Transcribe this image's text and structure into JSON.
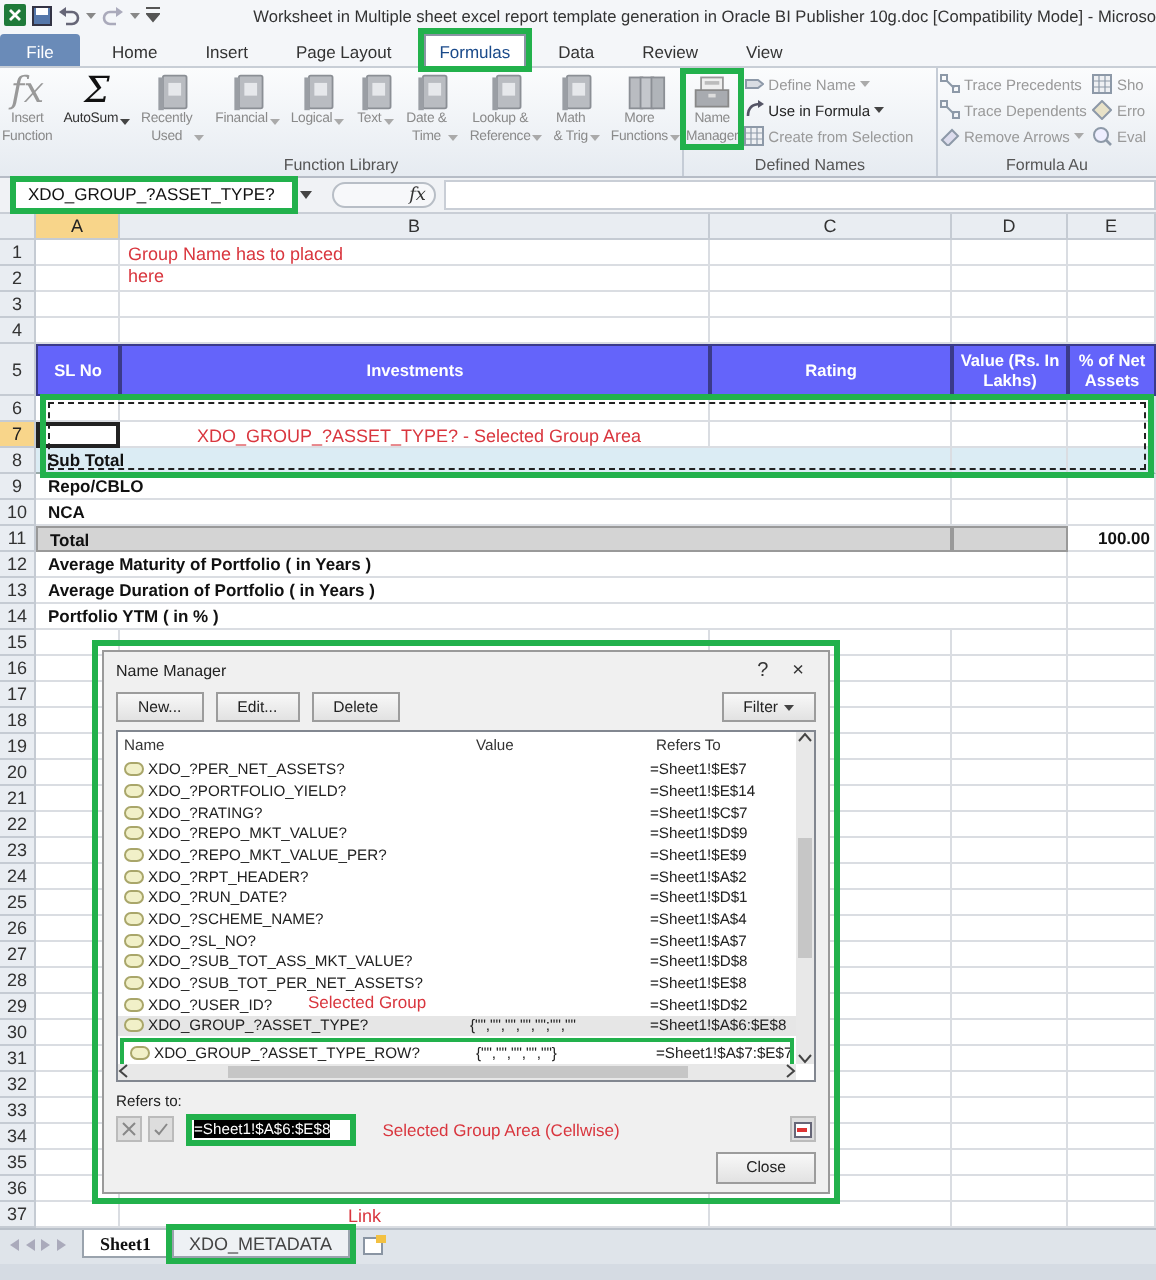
{
  "title_bar": {
    "title": "Worksheet in Multiple sheet excel report template generation in Oracle BI Publisher 10g.doc  [Compatibility Mode]  -  Microso"
  },
  "ribbon_tabs": [
    {
      "label": "File",
      "kind": "file",
      "selected": false,
      "highlighted": false
    },
    {
      "label": "Home",
      "kind": "tab",
      "selected": false,
      "highlighted": false
    },
    {
      "label": "Insert",
      "kind": "tab",
      "selected": false,
      "highlighted": false
    },
    {
      "label": "Page Layout",
      "kind": "tab",
      "selected": false,
      "highlighted": false
    },
    {
      "label": "Formulas",
      "kind": "tab",
      "selected": true,
      "highlighted": true
    },
    {
      "label": "Data",
      "kind": "tab",
      "selected": false,
      "highlighted": false
    },
    {
      "label": "Review",
      "kind": "tab",
      "selected": false,
      "highlighted": false
    },
    {
      "label": "View",
      "kind": "tab",
      "selected": false,
      "highlighted": false
    }
  ],
  "ribbon": {
    "groups": [
      {
        "label": "Function Library",
        "buttons": [
          {
            "label": "Insert\nFunction",
            "kind": "glyph",
            "glyph": "fx",
            "disabled": true,
            "dropdown": false,
            "highlighted": false
          },
          {
            "label": "AutoSum",
            "kind": "glyph",
            "glyph": "Σ",
            "disabled": false,
            "dropdown": true,
            "highlighted": false
          },
          {
            "label": "Recently\nUsed",
            "kind": "book",
            "disabled": true,
            "dropdown": true,
            "highlighted": false
          },
          {
            "label": "Financial",
            "kind": "book",
            "disabled": true,
            "dropdown": true,
            "highlighted": false
          },
          {
            "label": "Logical",
            "kind": "book",
            "disabled": true,
            "dropdown": true,
            "highlighted": false
          },
          {
            "label": "Text",
            "kind": "book",
            "disabled": true,
            "dropdown": true,
            "highlighted": false
          },
          {
            "label": "Date &\nTime",
            "kind": "book",
            "disabled": true,
            "dropdown": true,
            "highlighted": false
          },
          {
            "label": "Lookup &\nReference",
            "kind": "book",
            "disabled": true,
            "dropdown": true,
            "highlighted": false
          },
          {
            "label": "Math\n& Trig",
            "kind": "book",
            "disabled": true,
            "dropdown": true,
            "highlighted": false
          },
          {
            "label": "More\nFunctions",
            "kind": "books",
            "disabled": true,
            "dropdown": true,
            "highlighted": false
          }
        ]
      },
      {
        "label": "Defined Names",
        "buttons": [
          {
            "label": "Name\nManager",
            "kind": "card-file",
            "disabled": true,
            "dropdown": false,
            "highlighted": true
          }
        ],
        "small_buttons": [
          {
            "label": "Define Name",
            "kind": "tag",
            "disabled": true,
            "dropdown": true
          },
          {
            "label": "Use in Formula",
            "kind": "curve",
            "disabled": false,
            "dropdown": true
          },
          {
            "label": "Create from Selection",
            "kind": "grid",
            "disabled": true,
            "dropdown": false
          }
        ]
      },
      {
        "label": "Formula Au",
        "small_buttons": [
          {
            "label": "Trace Precedents",
            "kind": "trace",
            "disabled": true,
            "dropdown": false
          },
          {
            "label": "Trace Dependents",
            "kind": "trace",
            "disabled": true,
            "dropdown": false
          },
          {
            "label": "Remove Arrows",
            "kind": "eraser",
            "disabled": true,
            "dropdown": true
          }
        ],
        "small_buttons_2": [
          {
            "label": "Sho",
            "kind": "grid",
            "disabled": true
          },
          {
            "label": "Erro",
            "kind": "diamond",
            "disabled": true
          },
          {
            "label": "Eval",
            "kind": "magnifier",
            "disabled": true
          }
        ]
      }
    ]
  },
  "formula_bar": {
    "name_box": "XDO_GROUP_?ASSET_TYPE?",
    "name_box_highlighted": true,
    "function_symbol": "fx"
  },
  "sheet": {
    "note": "Group Name has to placed here",
    "columns": [
      {
        "label": "A",
        "selected": true
      },
      {
        "label": "B",
        "selected": false
      },
      {
        "label": "C",
        "selected": false
      },
      {
        "label": "D",
        "selected": false
      },
      {
        "label": "E",
        "selected": false
      }
    ],
    "rows": [
      {
        "number": "1",
        "kind": "plain",
        "selected": false,
        "highlighted": false
      },
      {
        "number": "2",
        "kind": "plain",
        "selected": false,
        "highlighted": false
      },
      {
        "number": "3",
        "kind": "plain",
        "selected": false,
        "highlighted": false
      },
      {
        "number": "4",
        "kind": "plain",
        "selected": false,
        "highlighted": false
      },
      {
        "number": "5",
        "kind": "header",
        "selected": false,
        "highlighted": false,
        "cells": [
          {
            "text": "SL No"
          },
          {
            "text": "Investments"
          },
          {
            "text": "Rating"
          },
          {
            "text": "Value (Rs. In Lakhs)"
          },
          {
            "text": "% of Net Assets"
          }
        ]
      },
      {
        "number": "6",
        "kind": "plain",
        "selected": false,
        "highlighted": true
      },
      {
        "number": "7",
        "kind": "plain",
        "selected": true,
        "highlighted": true,
        "cells": [
          {
            "kind": "plain"
          },
          {
            "kind": "note",
            "text": "XDO_GROUP_?ASSET_TYPE? - Selected Group Area"
          },
          {
            "kind": "plain"
          },
          {
            "kind": "plain"
          },
          {
            "kind": "plain"
          }
        ]
      },
      {
        "number": "8",
        "kind": "subtotal",
        "selected": false,
        "highlighted": true,
        "cells": [
          {
            "text": "Sub Total"
          },
          {},
          {}
        ]
      },
      {
        "number": "9",
        "kind": "plain",
        "selected": false,
        "highlighted": false,
        "cells": [
          {
            "text": "Repo/CBLO"
          },
          {},
          {}
        ]
      },
      {
        "number": "10",
        "kind": "plain",
        "selected": false,
        "highlighted": false,
        "cells": [
          {
            "text": "NCA"
          },
          {},
          {}
        ]
      },
      {
        "number": "11",
        "kind": "total",
        "selected": false,
        "highlighted": false,
        "cells": [
          {
            "text": "Total",
            "shaded": true
          },
          {
            "shaded": true
          },
          {
            "text": "100.00",
            "shaded": false
          }
        ]
      },
      {
        "number": "12",
        "kind": "plain",
        "selected": false,
        "highlighted": false,
        "cells": [
          {
            "text": "Average Maturity of Portfolio ( in Years )"
          },
          {}
        ]
      },
      {
        "number": "13",
        "kind": "plain",
        "selected": false,
        "highlighted": false,
        "cells": [
          {
            "text": "Average Duration of Portfolio ( in Years )"
          },
          {}
        ]
      },
      {
        "number": "14",
        "kind": "plain",
        "selected": false,
        "highlighted": false,
        "cells": [
          {
            "text": "Portfolio YTM ( in % )"
          },
          {}
        ]
      },
      {
        "number": "15",
        "kind": "plain",
        "selected": false,
        "highlighted": false
      },
      {
        "number": "16",
        "kind": "plain",
        "selected": false,
        "highlighted": false
      },
      {
        "number": "17",
        "kind": "plain",
        "selected": false,
        "highlighted": false
      },
      {
        "number": "18",
        "kind": "plain",
        "selected": false,
        "highlighted": false
      },
      {
        "number": "19",
        "kind": "plain",
        "selected": false,
        "highlighted": false
      },
      {
        "number": "20",
        "kind": "plain",
        "selected": false,
        "highlighted": false
      },
      {
        "number": "21",
        "kind": "plain",
        "selected": false,
        "highlighted": false
      },
      {
        "number": "22",
        "kind": "plain",
        "selected": false,
        "highlighted": false
      },
      {
        "number": "23",
        "kind": "plain",
        "selected": false,
        "highlighted": false
      },
      {
        "number": "24",
        "kind": "plain",
        "selected": false,
        "highlighted": false
      },
      {
        "number": "25",
        "kind": "plain",
        "selected": false,
        "highlighted": false
      },
      {
        "number": "26",
        "kind": "plain",
        "selected": false,
        "highlighted": false
      },
      {
        "number": "27",
        "kind": "plain",
        "selected": false,
        "highlighted": false
      },
      {
        "number": "28",
        "kind": "plain",
        "selected": false,
        "highlighted": false
      },
      {
        "number": "29",
        "kind": "plain",
        "selected": false,
        "highlighted": false
      },
      {
        "number": "30",
        "kind": "plain",
        "selected": false,
        "highlighted": false
      },
      {
        "number": "31",
        "kind": "plain",
        "selected": false,
        "highlighted": false
      },
      {
        "number": "32",
        "kind": "plain",
        "selected": false,
        "highlighted": false
      },
      {
        "number": "33",
        "kind": "plain",
        "selected": false,
        "highlighted": false
      },
      {
        "number": "34",
        "kind": "plain",
        "selected": false,
        "highlighted": false
      },
      {
        "number": "35",
        "kind": "plain",
        "selected": false,
        "highlighted": false
      },
      {
        "number": "36",
        "kind": "plain",
        "selected": false,
        "highlighted": false
      },
      {
        "number": "37",
        "kind": "plain",
        "selected": false,
        "highlighted": false
      }
    ]
  },
  "name_manager": {
    "title": "Name Manager",
    "help": "?",
    "close": "×",
    "highlighted": true,
    "buttons": [
      {
        "label": "New..."
      },
      {
        "label": "Edit..."
      },
      {
        "label": "Delete"
      }
    ],
    "filter": {
      "label": "Filter",
      "dropdown": true
    },
    "columns": [
      "Name",
      "Value",
      "Refers To"
    ],
    "names": [
      {
        "name": "XDO_?PER_NET_ASSETS?",
        "refers_to": "=Sheet1!$E$7",
        "selected": false,
        "highlighted": false
      },
      {
        "name": "XDO_?PORTFOLIO_YIELD?",
        "refers_to": "=Sheet1!$E$14",
        "selected": false,
        "highlighted": false
      },
      {
        "name": "XDO_?RATING?",
        "refers_to": "=Sheet1!$C$7",
        "selected": false,
        "highlighted": false
      },
      {
        "name": "XDO_?REPO_MKT_VALUE?",
        "refers_to": "=Sheet1!$D$9",
        "selected": false,
        "highlighted": false
      },
      {
        "name": "XDO_?REPO_MKT_VALUE_PER?",
        "refers_to": "=Sheet1!$E$9",
        "selected": false,
        "highlighted": false
      },
      {
        "name": "XDO_?RPT_HEADER?",
        "refers_to": "=Sheet1!$A$2",
        "selected": false,
        "highlighted": false
      },
      {
        "name": "XDO_?RUN_DATE?",
        "refers_to": "=Sheet1!$D$1",
        "selected": false,
        "highlighted": false
      },
      {
        "name": "XDO_?SCHEME_NAME?",
        "refers_to": "=Sheet1!$A$4",
        "selected": false,
        "highlighted": false
      },
      {
        "name": "XDO_?SL_NO?",
        "refers_to": "=Sheet1!$A$7",
        "selected": false,
        "highlighted": false
      },
      {
        "name": "XDO_?SUB_TOT_ASS_MKT_VALUE?",
        "refers_to": "=Sheet1!$D$8",
        "selected": false,
        "highlighted": false
      },
      {
        "name": "XDO_?SUB_TOT_PER_NET_ASSETS?",
        "refers_to": "=Sheet1!$E$8",
        "selected": false,
        "highlighted": false
      },
      {
        "name": "XDO_?USER_ID?",
        "refers_to": "=Sheet1!$D$2",
        "selected": false,
        "highlighted": false
      },
      {
        "name": "XDO_GROUP_?ASSET_TYPE?",
        "value": "{\"\",\"\",\"\",\"\",\"\";\"\",\"\"",
        "refers_to": "=Sheet1!$A$6:$E$8",
        "selected": true,
        "highlighted": false
      },
      {
        "name": "XDO_GROUP_?ASSET_TYPE_ROW?",
        "value": "{\"\",\"\",\"\",\"\",\"\"}",
        "refers_to": "=Sheet1!$A$7:$E$7",
        "selected": false,
        "highlighted": true
      }
    ],
    "list_note": "Selected Group",
    "refers_label": "Refers to:",
    "refers_value": "=Sheet1!$A$6:$E$8",
    "refers_highlighted": true,
    "field_note": "Selected Group Area (Cellwise)",
    "close_button": "Close"
  },
  "sheet_tabs": {
    "note": "Link",
    "tabs": [
      {
        "label": "Sheet1",
        "selected": true,
        "highlighted": false
      },
      {
        "label": "XDO_METADATA",
        "selected": false,
        "highlighted": true
      }
    ]
  }
}
